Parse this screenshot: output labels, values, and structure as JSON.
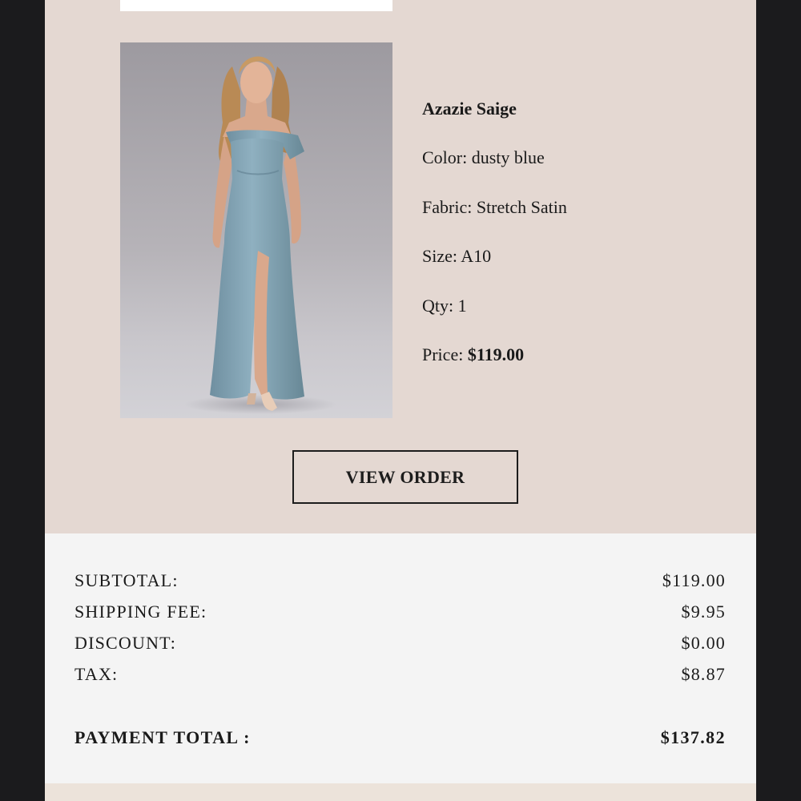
{
  "product": {
    "image_alt": "Model wearing a dusty blue off-shoulder stretch satin gown",
    "name": "Azazie Saige",
    "color_label": "Color:",
    "color_value": "dusty blue",
    "fabric_label": "Fabric:",
    "fabric_value": "Stretch Satin",
    "size_label": "Size:",
    "size_value": "A10",
    "qty_label": "Qty:",
    "qty_value": "1",
    "price_label": "Price:",
    "price_value": "$119.00"
  },
  "actions": {
    "view_order_label": "VIEW ORDER"
  },
  "summary": {
    "subtotal_label": "SUBTOTAL:",
    "subtotal_value": "$119.00",
    "shipping_label": "SHIPPING FEE:",
    "shipping_value": "$9.95",
    "discount_label": "DISCOUNT:",
    "discount_value": "$0.00",
    "tax_label": "TAX:",
    "tax_value": "$8.87",
    "total_label": "PAYMENT TOTAL :",
    "total_value": "$137.82"
  },
  "colors": {
    "panel_background": "#e4d8d2",
    "summary_background": "#f4f4f4",
    "page_background": "#1b1b1d",
    "dress": "#7f9fb0"
  }
}
